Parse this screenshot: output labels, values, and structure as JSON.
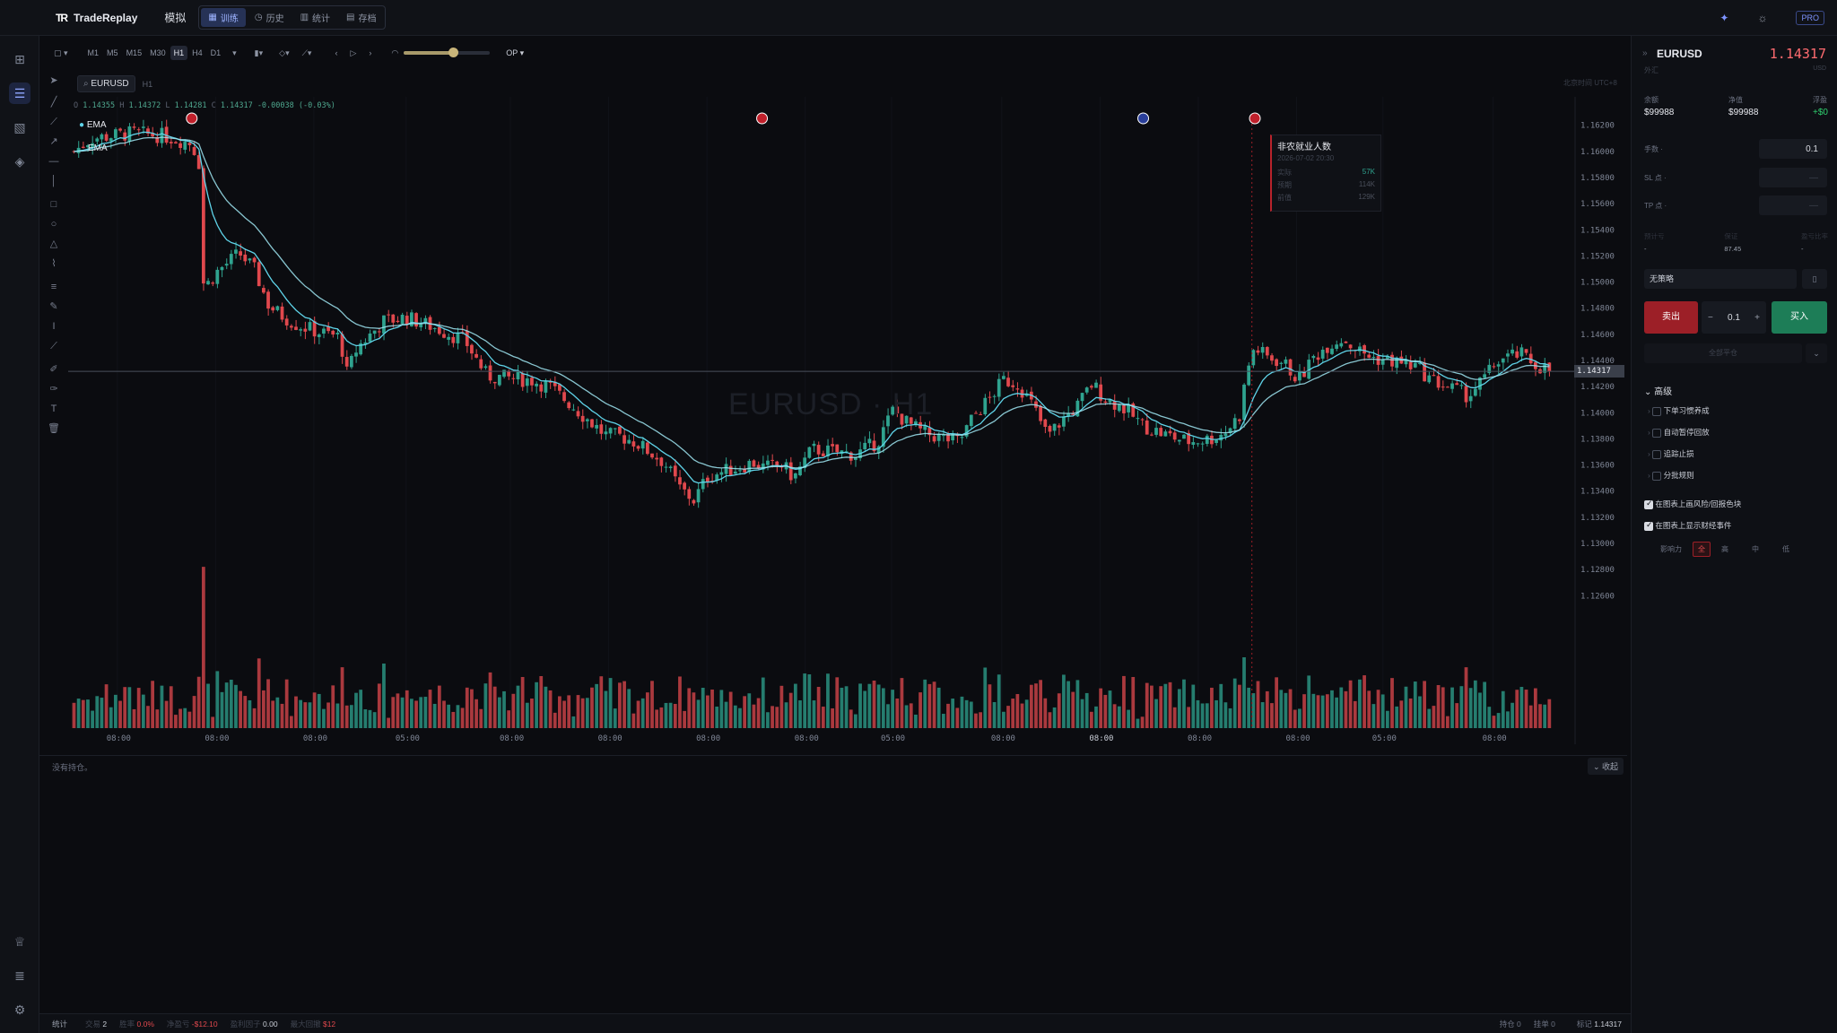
{
  "app": {
    "name": "TradeReplay",
    "mode": "模拟"
  },
  "nav_tabs": [
    {
      "label": "训练",
      "icon": "grid-icon",
      "active": true
    },
    {
      "label": "历史",
      "icon": "clock-icon",
      "active": false
    },
    {
      "label": "统计",
      "icon": "bar-chart-icon",
      "active": false
    },
    {
      "label": "存档",
      "icon": "archive-icon",
      "active": false
    }
  ],
  "top_right": {
    "badge": "PRO"
  },
  "toolbar": {
    "timeframes": [
      "M1",
      "M5",
      "M15",
      "M30",
      "H1",
      "H4",
      "D1"
    ],
    "active_timeframe": "H1",
    "replay_mode": "OP"
  },
  "chart": {
    "symbol": "EURUSD",
    "interval": "H1",
    "watermark": "EURUSD · H1",
    "timezone_label": "北京时间 UTC+8",
    "ohlc": {
      "o": "1.14355",
      "h": "1.14372",
      "l": "1.14281",
      "c": "1.14317",
      "chg": "-0.00038 (-0.03%)"
    },
    "indicators": [
      "EMA",
      "EMA"
    ],
    "current_price": "1.14317",
    "event_popup": {
      "title": "非农就业人数",
      "datetime": "2026-07-02 20:30",
      "rows": [
        {
          "label": "实际",
          "value": "57K"
        },
        {
          "label": "预期",
          "value": "114K"
        },
        {
          "label": "前值",
          "value": "129K"
        }
      ]
    }
  },
  "chart_data": {
    "type": "candlestick",
    "symbol": "EURUSD",
    "interval": "H1",
    "y_ticks": [
      "1.16200",
      "1.16000",
      "1.15800",
      "1.15600",
      "1.15400",
      "1.15200",
      "1.15000",
      "1.14800",
      "1.14600",
      "1.14400",
      "1.14200",
      "1.14000",
      "1.13800",
      "1.13600",
      "1.13400",
      "1.13200",
      "1.13000",
      "1.12800",
      "1.12600"
    ],
    "ylim": [
      1.1252,
      1.1628
    ],
    "x_ticks": [
      "08:00",
      "08:00",
      "08:00",
      "05:00",
      "08:00",
      "08:00",
      "08:00",
      "08:00",
      "05:00",
      "08:00",
      "08:00",
      "08:00",
      "08:00",
      "05:00",
      "08:00"
    ],
    "x_tick_fraction": [
      0.033,
      0.099,
      0.165,
      0.227,
      0.297,
      0.363,
      0.429,
      0.495,
      0.553,
      0.627,
      0.693,
      0.759,
      0.825,
      0.883,
      0.957
    ],
    "price_path": [
      [
        0.0,
        1.16
      ],
      [
        0.012,
        1.161
      ],
      [
        0.04,
        1.1614
      ],
      [
        0.06,
        1.1612
      ],
      [
        0.08,
        1.1606
      ],
      [
        0.085,
        1.159
      ],
      [
        0.086,
        1.1535
      ],
      [
        0.088,
        1.1495
      ],
      [
        0.097,
        1.1508
      ],
      [
        0.112,
        1.1522
      ],
      [
        0.122,
        1.151
      ],
      [
        0.132,
        1.1482
      ],
      [
        0.14,
        1.1475
      ],
      [
        0.15,
        1.1468
      ],
      [
        0.165,
        1.1462
      ],
      [
        0.18,
        1.1458
      ],
      [
        0.185,
        1.143
      ],
      [
        0.192,
        1.145
      ],
      [
        0.21,
        1.147
      ],
      [
        0.225,
        1.1473
      ],
      [
        0.245,
        1.1465
      ],
      [
        0.265,
        1.1455
      ],
      [
        0.28,
        1.1428
      ],
      [
        0.31,
        1.1425
      ],
      [
        0.322,
        1.142
      ],
      [
        0.335,
        1.1408
      ],
      [
        0.345,
        1.1398
      ],
      [
        0.36,
        1.1383
      ],
      [
        0.37,
        1.1382
      ],
      [
        0.38,
        1.1378
      ],
      [
        0.39,
        1.137
      ],
      [
        0.4,
        1.1362
      ],
      [
        0.41,
        1.1343
      ],
      [
        0.42,
        1.1333
      ],
      [
        0.43,
        1.1352
      ],
      [
        0.45,
        1.1358
      ],
      [
        0.46,
        1.1362
      ],
      [
        0.468,
        1.1358
      ],
      [
        0.48,
        1.136
      ],
      [
        0.488,
        1.135
      ],
      [
        0.5,
        1.1372
      ],
      [
        0.515,
        1.137
      ],
      [
        0.53,
        1.1368
      ],
      [
        0.545,
        1.1378
      ],
      [
        0.555,
        1.1402
      ],
      [
        0.565,
        1.1392
      ],
      [
        0.575,
        1.1385
      ],
      [
        0.59,
        1.138
      ],
      [
        0.6,
        1.1378
      ],
      [
        0.61,
        1.1398
      ],
      [
        0.62,
        1.141
      ],
      [
        0.63,
        1.1425
      ],
      [
        0.64,
        1.1422
      ],
      [
        0.65,
        1.1405
      ],
      [
        0.66,
        1.1382
      ],
      [
        0.67,
        1.1395
      ],
      [
        0.68,
        1.1405
      ],
      [
        0.69,
        1.1422
      ],
      [
        0.7,
        1.141
      ],
      [
        0.71,
        1.1405
      ],
      [
        0.725,
        1.139
      ],
      [
        0.74,
        1.1383
      ],
      [
        0.755,
        1.1378
      ],
      [
        0.77,
        1.138
      ],
      [
        0.78,
        1.1385
      ],
      [
        0.79,
        1.1398
      ],
      [
        0.795,
        1.1432
      ],
      [
        0.8,
        1.145
      ],
      [
        0.808,
        1.1443
      ],
      [
        0.82,
        1.1438
      ],
      [
        0.83,
        1.1425
      ],
      [
        0.84,
        1.1442
      ],
      [
        0.85,
        1.1452
      ],
      [
        0.86,
        1.1457
      ],
      [
        0.87,
        1.1448
      ],
      [
        0.88,
        1.1442
      ],
      [
        0.89,
        1.144
      ],
      [
        0.9,
        1.1438
      ],
      [
        0.91,
        1.1435
      ],
      [
        0.92,
        1.1425
      ],
      [
        0.935,
        1.1418
      ],
      [
        0.945,
        1.1413
      ],
      [
        0.955,
        1.1425
      ],
      [
        0.965,
        1.144
      ],
      [
        0.98,
        1.1445
      ],
      [
        0.992,
        1.1436
      ],
      [
        1.0,
        1.1432
      ]
    ],
    "latest": {
      "open": 1.14355,
      "high": 1.14372,
      "low": 1.14281,
      "close": 1.14317
    }
  },
  "right_panel": {
    "symbol": "EURUSD",
    "category": "外汇",
    "price": "1.14317",
    "currency": "USD",
    "stats": [
      {
        "label": "余额",
        "value": "$99988"
      },
      {
        "label": "净值",
        "value": "$99988"
      },
      {
        "label": "浮盈",
        "value": "+$0"
      }
    ],
    "lots_label": "手数",
    "lots_value": "0.1",
    "sl_label": "SL 点",
    "sl_value": "—",
    "tp_label": "TP 点",
    "tp_value": "—",
    "risk": [
      {
        "label": "预计亏",
        "value": "-"
      },
      {
        "label": "保证",
        "value": "87.45"
      },
      {
        "label": "盈亏比率",
        "value": "-"
      }
    ],
    "strategy": "无策略",
    "sell_label": "卖出",
    "buy_label": "买入",
    "qty": "0.1",
    "close_all": "全部平仓",
    "advanced_title": "高级",
    "advanced_items": [
      "下单习惯养成",
      "自动暂停回放",
      "追踪止损",
      "分批规则"
    ],
    "options": [
      "在图表上画风险/回报色块",
      "在图表上显示财经事件"
    ],
    "impact_label": "影响力",
    "impact_levels": [
      "全",
      "高",
      "中",
      "低"
    ]
  },
  "positions": {
    "empty_text": "没有持仓。",
    "collapse_label": "收起"
  },
  "status_bar": {
    "label": "统计",
    "trades_label": "交易",
    "trades": "2",
    "winrate_label": "胜率",
    "winrate": "0.0%",
    "pnl_label": "净盈亏",
    "pnl": "-$12.10",
    "pf_label": "盈利因子",
    "pf": "0.00",
    "dd_label": "最大回撤",
    "dd": "$12",
    "holding_label": "持仓",
    "holding": "0",
    "pending_label": "挂单",
    "pending": "0",
    "mark_label": "标记",
    "mark": "1.14317"
  },
  "colors": {
    "up": "#2fa38f",
    "down": "#e0484d",
    "ema": "#5fd3e8",
    "accent": "#7d93ff",
    "buy": "#1f8a5e",
    "sell": "#b8232b"
  }
}
